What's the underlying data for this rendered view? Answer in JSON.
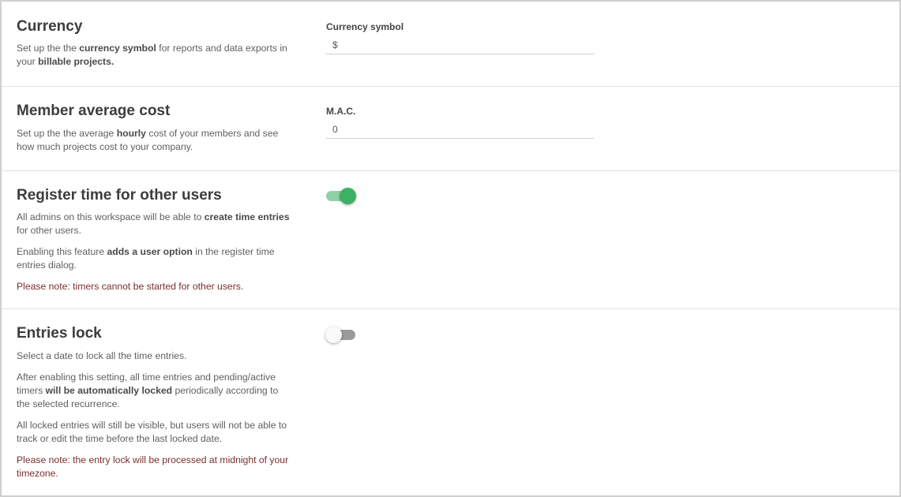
{
  "currency": {
    "title": "Currency",
    "desc_parts": [
      "Set up the the ",
      "currency symbol",
      " for reports and data exports in your ",
      "billable projects."
    ],
    "field_label": "Currency symbol",
    "field_value": "$"
  },
  "mac": {
    "title": "Member average cost",
    "desc_parts": [
      "Set up the the average ",
      "hourly",
      " cost of your members and see how much projects cost to your company."
    ],
    "field_label": "M.A.C.",
    "field_value": "0"
  },
  "register": {
    "title": "Register time for other users",
    "para1_parts": [
      "All admins on this workspace will be able to ",
      "create time entries",
      " for other users."
    ],
    "para2_parts": [
      "Enabling this feature ",
      "adds a user option",
      " in the register time entries dialog."
    ],
    "note": "Please note: timers cannot be started for other users.",
    "toggle_state": "on"
  },
  "lock": {
    "title": "Entries lock",
    "para1": "Select a date to lock all the time entries.",
    "para2_parts": [
      "After enabling this setting, all time entries and pending/active timers ",
      "will be automatically locked",
      " periodically according to the selected recurrence."
    ],
    "para3": "All locked entries will still be visible, but users will not be able to track or edit the time before the last locked date.",
    "note": "Please note: the entry lock will be processed at midnight of your timezone.",
    "toggle_state": "off"
  },
  "colors": {
    "toggle_on_knob": "#3cb065",
    "toggle_on_track": "#8fd1a4",
    "toggle_off_track": "#9a9a9a",
    "note_text": "#7a2e2e"
  }
}
